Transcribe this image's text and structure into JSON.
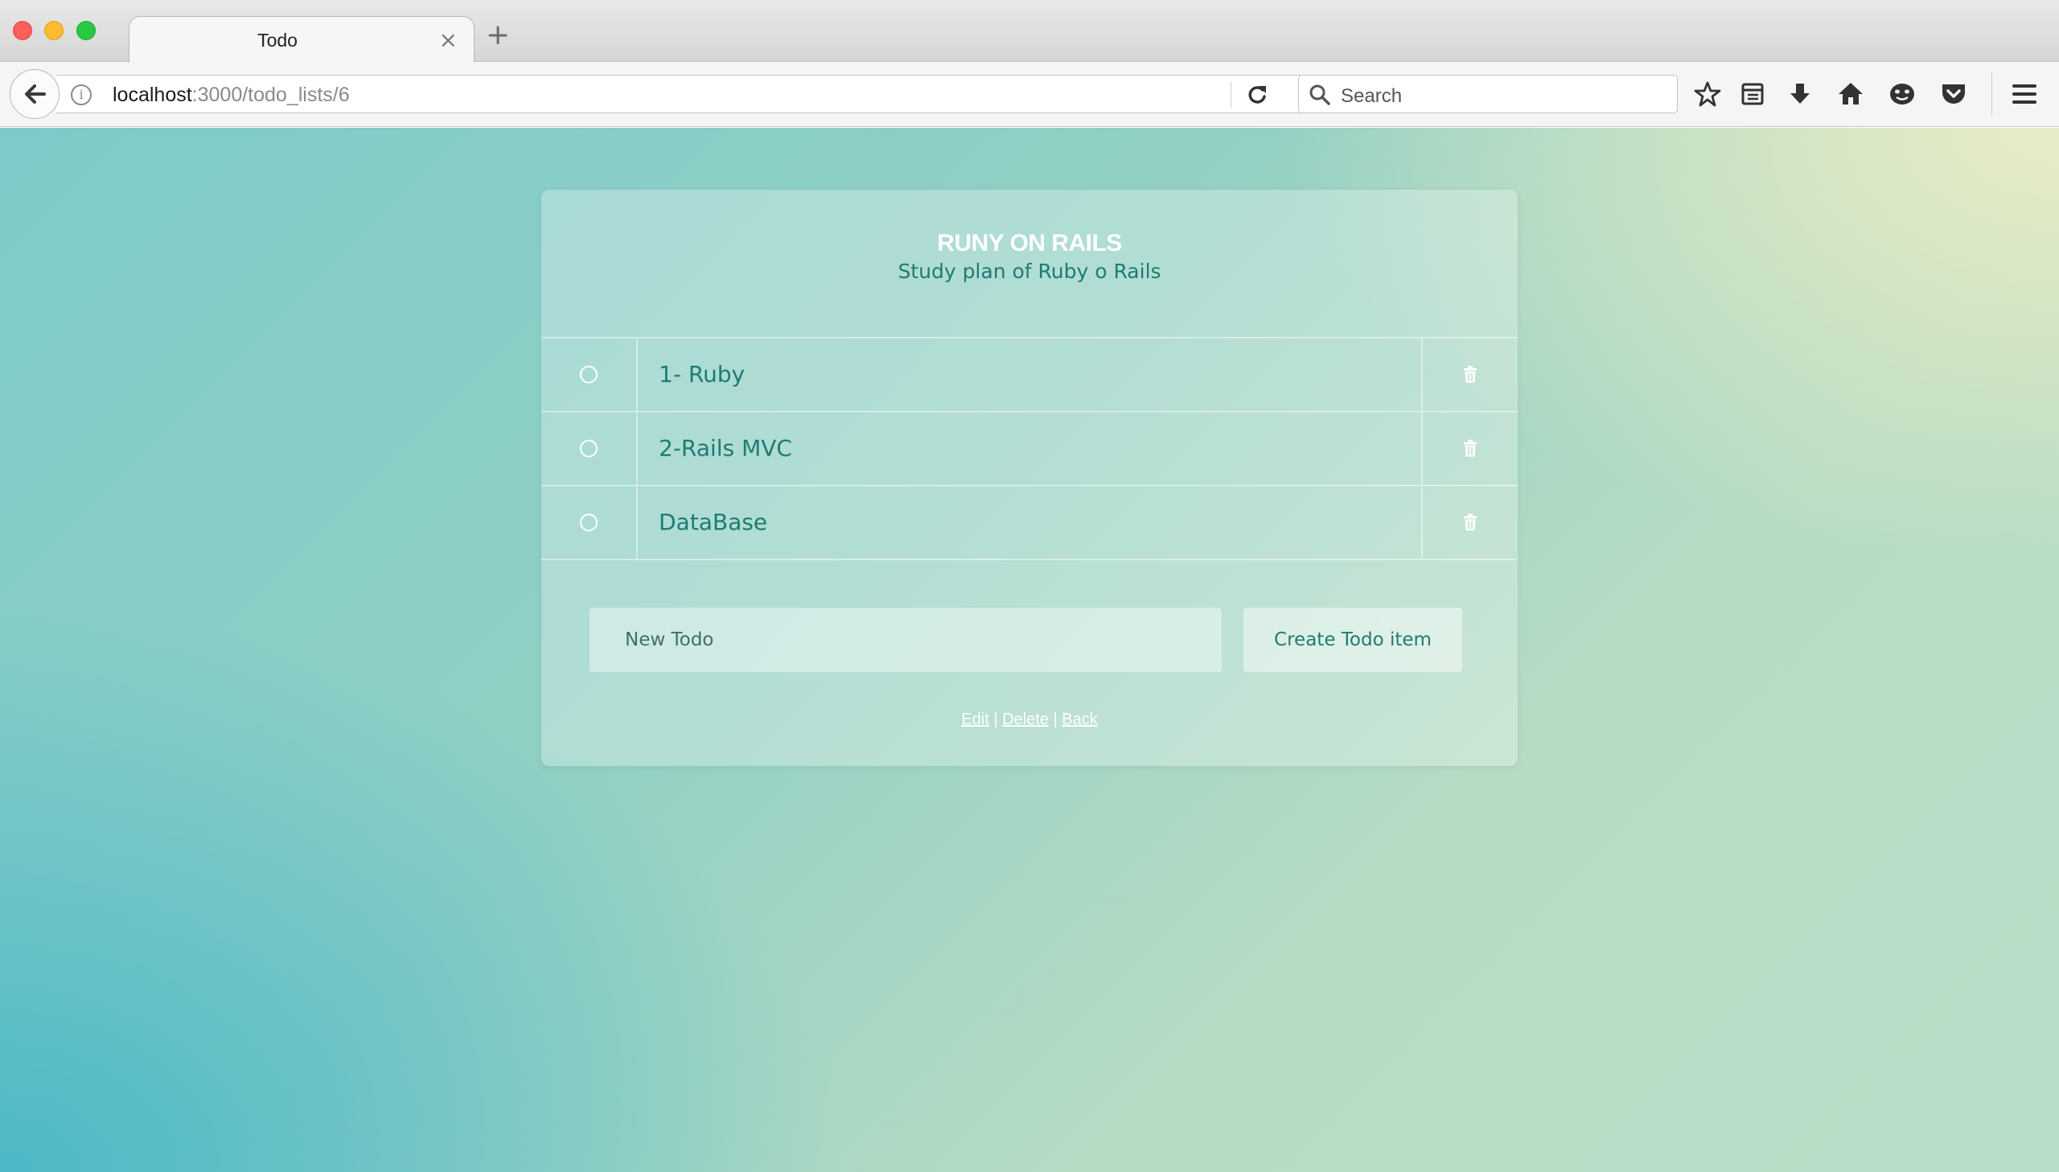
{
  "browser": {
    "tab_title": "Todo",
    "tab_close": "×",
    "new_tab": "+",
    "url_host": "localhost",
    "url_path": ":3000/todo_lists/6",
    "search_placeholder": "Search"
  },
  "list": {
    "title": "RUNY ON RAILS",
    "description": "Study plan of Ruby o Rails",
    "items": [
      {
        "label": "1- Ruby"
      },
      {
        "label": "2-Rails MVC"
      },
      {
        "label": "DataBase"
      }
    ]
  },
  "form": {
    "placeholder": "New Todo",
    "submit_label": "Create Todo item"
  },
  "links": {
    "edit": "Edit",
    "delete": "Delete",
    "back": "Back",
    "separator": "|"
  },
  "colors": {
    "accent_text": "#1f7b73",
    "background_teal": "#4cb8c6",
    "background_cream": "#e9ecc6"
  }
}
